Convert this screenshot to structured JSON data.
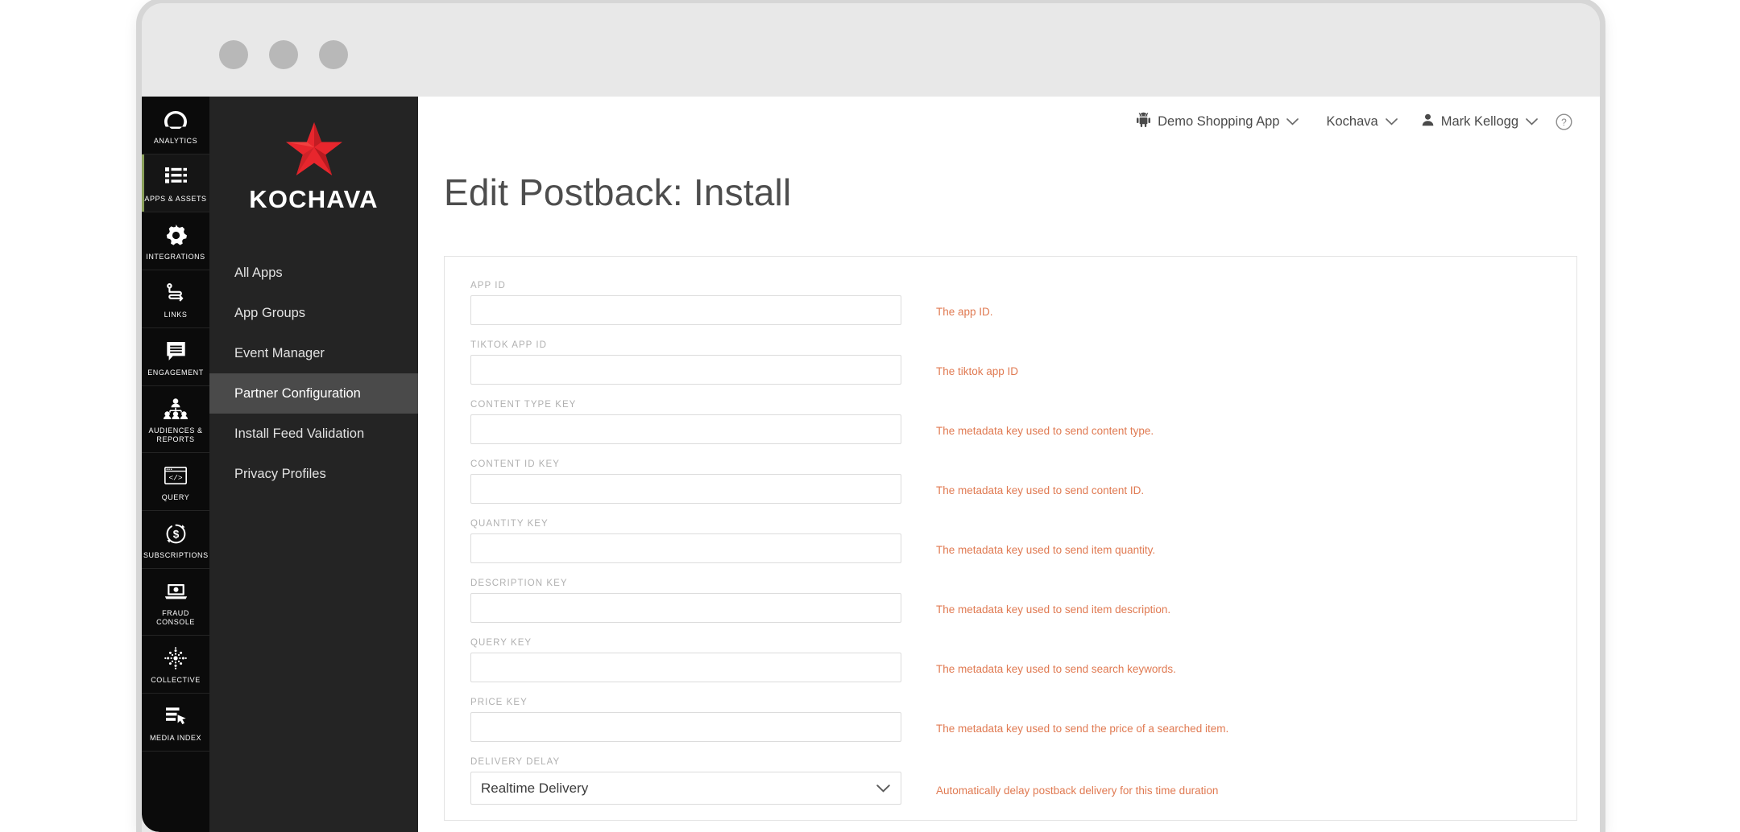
{
  "window": {
    "dots": [
      "window-dot",
      "window-dot",
      "window-dot"
    ]
  },
  "rail": {
    "items": [
      {
        "label": "ANALYTICS",
        "icon": "gauge-icon",
        "active": false
      },
      {
        "label": "APPS & ASSETS",
        "icon": "list-blocks-icon",
        "active": true
      },
      {
        "label": "INTEGRATIONS",
        "icon": "gear-icon",
        "active": false
      },
      {
        "label": "LINKS",
        "icon": "link-path-icon",
        "active": false
      },
      {
        "label": "ENGAGEMENT",
        "icon": "chat-bubble-icon",
        "active": false
      },
      {
        "label": "AUDIENCES & REPORTS",
        "icon": "people-group-icon",
        "active": false
      },
      {
        "label": "QUERY",
        "icon": "code-window-icon",
        "active": false
      },
      {
        "label": "SUBSCRIPTIONS",
        "icon": "dollar-refresh-icon",
        "active": false
      },
      {
        "label": "FRAUD CONSOLE",
        "icon": "laptop-icon",
        "active": false
      },
      {
        "label": "COLLECTIVE",
        "icon": "dotted-circle-icon",
        "active": false
      },
      {
        "label": "MEDIA INDEX",
        "icon": "list-cursor-icon",
        "active": false
      }
    ]
  },
  "brand": {
    "name": "KOCHAVA",
    "logo_icon": "kochava-star-logo",
    "star_color": "#e8262d"
  },
  "subnav": {
    "items": [
      {
        "label": "All Apps",
        "active": false
      },
      {
        "label": "App Groups",
        "active": false
      },
      {
        "label": "Event Manager",
        "active": false
      },
      {
        "label": "Partner Configuration",
        "active": true
      },
      {
        "label": "Install Feed Validation",
        "active": false
      },
      {
        "label": "Privacy Profiles",
        "active": false
      }
    ]
  },
  "topbar": {
    "app_icon": "android-robot-icon",
    "app_name": "Demo Shopping App",
    "account_name": "Kochava",
    "user_icon": "person-icon",
    "user_name": "Mark Kellogg",
    "help_icon": "help-circle-icon",
    "chevron_icon": "chevron-down-icon"
  },
  "page": {
    "title": "Edit Postback: Install"
  },
  "form": {
    "fields": [
      {
        "label": "APP ID",
        "value": "",
        "help": "The app ID.",
        "type": "text"
      },
      {
        "label": "TIKTOK APP ID",
        "value": "",
        "help": "The tiktok app ID",
        "type": "text"
      },
      {
        "label": "CONTENT TYPE KEY",
        "value": "",
        "help": "The metadata key used to send content type.",
        "type": "text"
      },
      {
        "label": "CONTENT ID KEY",
        "value": "",
        "help": "The metadata key used to send content ID.",
        "type": "text"
      },
      {
        "label": "QUANTITY KEY",
        "value": "",
        "help": "The metadata key used to send item quantity.",
        "type": "text"
      },
      {
        "label": "DESCRIPTION KEY",
        "value": "",
        "help": "The metadata key used to send item description.",
        "type": "text"
      },
      {
        "label": "QUERY KEY",
        "value": "",
        "help": "The metadata key used to send search keywords.",
        "type": "text"
      },
      {
        "label": "PRICE KEY",
        "value": "",
        "help": "The metadata key used to send the price of a searched item.",
        "type": "text"
      },
      {
        "label": "DELIVERY DELAY",
        "value": "Realtime Delivery",
        "help": "Automatically delay postback delivery for this time duration",
        "type": "select"
      }
    ]
  },
  "colors": {
    "help_text": "#e07a52",
    "rail_bg": "#0b0b0b",
    "subnav_bg": "#242424",
    "active_subnav": "#4a4a4a",
    "active_accent": "#8aa05a",
    "title_text": "#4d4d4d"
  }
}
